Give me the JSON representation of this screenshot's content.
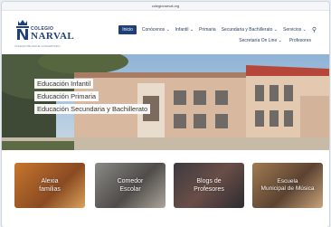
{
  "browser": {
    "url": "colegionarval.org"
  },
  "brand": {
    "line1": "COLEGIO",
    "line2": "NARVAL",
    "tagline": "COLEGIO BILINGÜE CONCERTADO"
  },
  "nav": {
    "row1": [
      "Inicio",
      "Conócenos ⌄",
      "Infantil ⌄",
      "Primaria",
      "Secundaria y Bachillerato ⌄",
      "Servicios ⌄"
    ],
    "row2": [
      "Secretaría On Line ⌄",
      "Profesores"
    ],
    "search_icon": "search-icon"
  },
  "hero": {
    "chips": [
      "Educación Infantil",
      "Educación Primaria",
      "Educación Secundaria y Bachillerato"
    ]
  },
  "cards": [
    {
      "label_line1": "Alexia",
      "label_line2": "familias"
    },
    {
      "label_line1": "Comedor",
      "label_line2": "Escolar"
    },
    {
      "label_line1": "Blogs de",
      "label_line2": "Profesores"
    },
    {
      "label_line1": "Escuela",
      "label_line2": "Municipal de Música"
    }
  ],
  "colors": {
    "brand": "#1f3f78",
    "accent": "#2c3e66"
  }
}
